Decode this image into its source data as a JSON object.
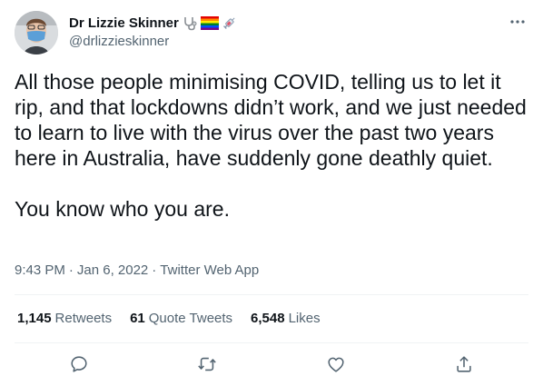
{
  "author": {
    "display_name": "Dr Lizzie Skinner",
    "handle": "@drlizzieskinner",
    "name_emojis": [
      "stethoscope-icon",
      "rainbow-flag-icon",
      "syringe-icon"
    ]
  },
  "tweet": {
    "paragraphs": [
      "All those people minimising COVID, telling us to let it rip, and that lockdowns didn’t work, and we just needed to learn to live with the virus over the past two years here in Australia, have suddenly gone deathly quiet.",
      "You know who you are."
    ]
  },
  "meta": {
    "time": "9:43 PM",
    "date": "Jan 6, 2022",
    "source": "Twitter Web App",
    "separator": "·"
  },
  "stats": {
    "retweets": {
      "count": "1,145",
      "label": "Retweets"
    },
    "quotes": {
      "count": "61",
      "label": "Quote Tweets"
    },
    "likes": {
      "count": "6,548",
      "label": "Likes"
    }
  },
  "colors": {
    "text": "#0f1419",
    "secondary": "#536471",
    "divider": "#eff3f4",
    "mask": "#5b9fd8"
  }
}
